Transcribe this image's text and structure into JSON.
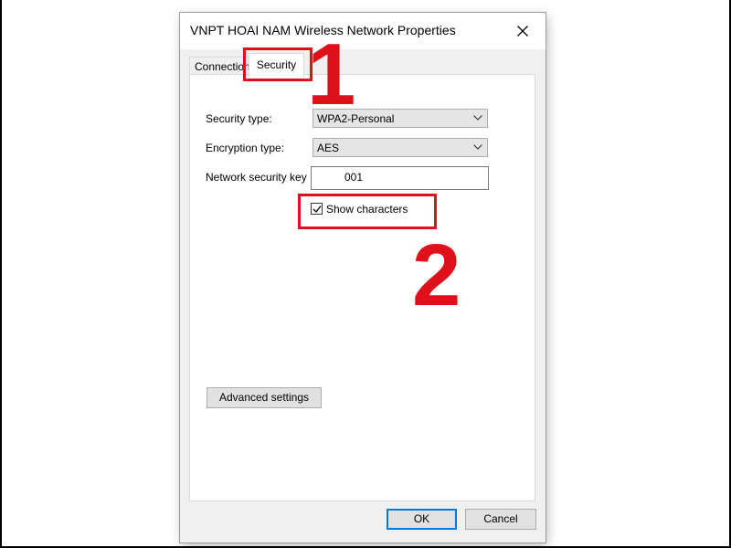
{
  "dialog": {
    "title": "VNPT HOAI NAM Wireless Network Properties",
    "close_icon": "close-icon"
  },
  "tabs": [
    {
      "label": "Connection",
      "active": false
    },
    {
      "label": "Security",
      "active": true
    }
  ],
  "security": {
    "security_type_label": "Security type:",
    "security_type_value": "WPA2-Personal",
    "encryption_type_label": "Encryption type:",
    "encryption_type_value": "AES",
    "network_key_label": "Network security key",
    "network_key_value": "001",
    "show_characters_label": "Show characters",
    "show_characters_checked": true,
    "advanced_settings_label": "Advanced settings"
  },
  "footer": {
    "ok_label": "OK",
    "cancel_label": "Cancel"
  },
  "annotations": {
    "step1": "1",
    "step2": "2",
    "highlight_color": "#e0101a"
  }
}
